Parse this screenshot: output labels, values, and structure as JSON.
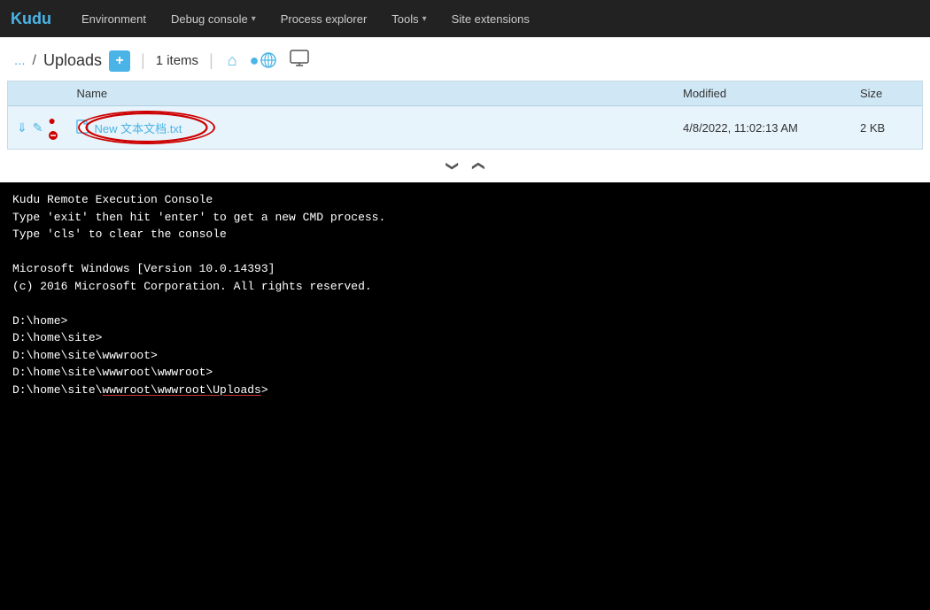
{
  "navbar": {
    "brand": "Kudu",
    "items": [
      {
        "label": "Environment",
        "dropdown": false
      },
      {
        "label": "Debug console",
        "dropdown": true
      },
      {
        "label": "Process explorer",
        "dropdown": false
      },
      {
        "label": "Tools",
        "dropdown": true
      },
      {
        "label": "Site extensions",
        "dropdown": false
      }
    ]
  },
  "breadcrumb": {
    "ellipsis": "...",
    "separator": "/",
    "current": "Uploads",
    "new_button_label": "+",
    "divider": "|",
    "items_count": "1 items",
    "divider2": "|"
  },
  "toolbar": {
    "home_icon": "🏠",
    "globe_icon": "🌐",
    "monitor_icon": "🖥"
  },
  "table": {
    "headers": [
      "Name",
      "Modified",
      "Size"
    ],
    "rows": [
      {
        "name": "New 文本文档.txt",
        "modified": "4/8/2022, 11:02:13 AM",
        "size": "2 KB"
      }
    ]
  },
  "resize": {
    "down_arrow": "❯",
    "up_arrow": "❯"
  },
  "console": {
    "lines": [
      "Kudu Remote Execution Console",
      "Type 'exit' then hit 'enter' to get a new CMD process.",
      "Type 'cls' to clear the console",
      "",
      "Microsoft Windows [Version 10.0.14393]",
      "(c) 2016 Microsoft Corporation. All rights reserved.",
      "",
      "D:\\home>",
      "D:\\home\\site>",
      "D:\\home\\site\\wwwroot>",
      "D:\\home\\site\\wwwroot\\wwwroot>"
    ],
    "last_line_prefix": "D:\\home\\site\\",
    "last_line_underlined": "wwwroot\\wwwroot\\Uploads",
    "last_line_suffix": ">"
  }
}
